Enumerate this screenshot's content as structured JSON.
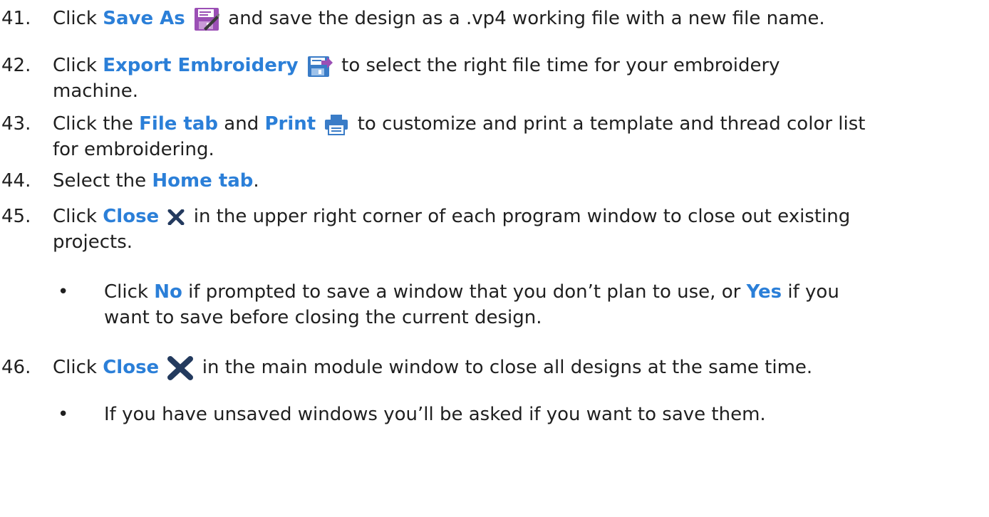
{
  "steps": [
    {
      "num": "41.",
      "pre": "Click ",
      "highlight": "Save As",
      "icon": "save-as-icon",
      "post": " and save the design as a .vp4 working file with a new file name."
    },
    {
      "num": "42.",
      "pre": "Click ",
      "highlight": "Export Embroidery",
      "icon": "export-embroidery-icon",
      "post_line1": " to select the right file time for your embroidery",
      "post_line2": "machine."
    },
    {
      "num": "43.",
      "pre": "Click the ",
      "highlight1": "File tab",
      "mid": " and ",
      "highlight2": "Print",
      "icon": "print-icon",
      "post_line1": " to customize and print a template and thread color list",
      "post_line2": "for embroidering."
    },
    {
      "num": "44.",
      "pre": "Select the ",
      "highlight": "Home tab",
      "post": "."
    },
    {
      "num": "45.",
      "pre": "Click ",
      "highlight": "Close",
      "icon": "close-icon",
      "post_line1": " in the upper right corner of each program window to close out existing",
      "post_line2": "projects.",
      "sub": {
        "bullet": "•",
        "pre": "Click ",
        "highlight1": "No",
        "mid": " if prompted to save a window that you don’t plan to use, or ",
        "highlight2": "Yes",
        "post_line1": " if you",
        "line2": "want to save before closing the current design."
      }
    },
    {
      "num": "46.",
      "pre": "Click ",
      "highlight": "Close",
      "icon": "close-icon-large",
      "post": " in the main module window to close all designs at the same time.",
      "sub": {
        "bullet": "•",
        "text": "If you have unsaved windows you’ll be asked if you want to save them."
      }
    }
  ],
  "colors": {
    "highlight": "#2b7fd8",
    "text": "#1f1f1f",
    "icon_purple": "#9b4fb5",
    "icon_blue": "#3a7cc7",
    "icon_navy": "#233a5e"
  }
}
